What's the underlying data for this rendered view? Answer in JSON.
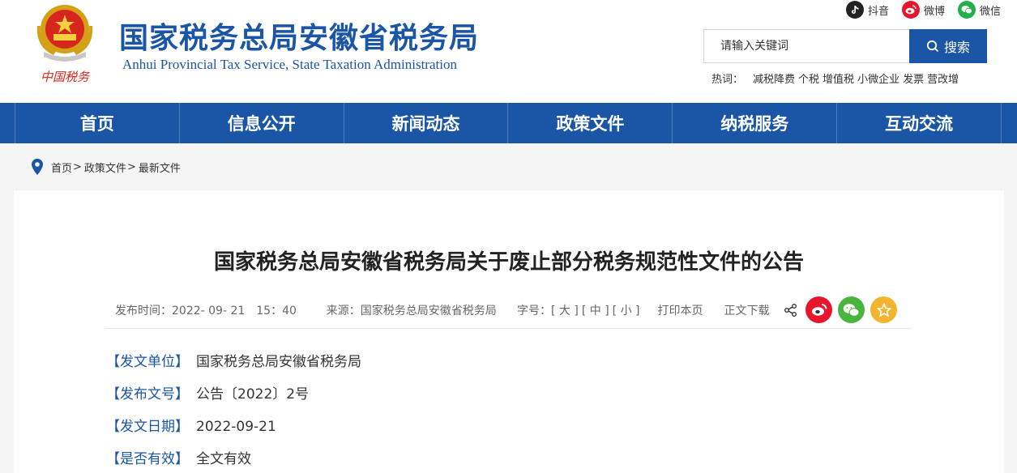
{
  "site": {
    "title": "国家税务总局安徽省税务局",
    "subtitle": "Anhui Provincial Tax Service, State Taxation Administration",
    "emblem_caption": "中国税务"
  },
  "social": [
    {
      "label": "抖音",
      "icon": "douyin-icon",
      "color": "#222222"
    },
    {
      "label": "微博",
      "icon": "weibo-icon",
      "color": "#e6162d"
    },
    {
      "label": "微信",
      "icon": "wechat-icon",
      "color": "#21b04b"
    }
  ],
  "search": {
    "placeholder": "请输入关键词",
    "button_label": "搜索"
  },
  "hotwords": {
    "label": "热词：",
    "items": [
      "减税降费",
      "个税",
      "增值税",
      "小微企业",
      "发票",
      "营改增"
    ]
  },
  "nav": {
    "items": [
      "首页",
      "信息公开",
      "新闻动态",
      "政策文件",
      "纳税服务",
      "互动交流"
    ]
  },
  "breadcrumb": {
    "items": [
      "首页",
      "政策文件",
      "最新文件"
    ],
    "separator": ">"
  },
  "article": {
    "title": "国家税务总局安徽省税务局关于废止部分税务规范性文件的公告",
    "publish_time": "发布时间：2022- 09- 21　15：40",
    "source": "来源：国家税务总局安徽省税务局",
    "font_size_label": "字号：",
    "font_large": "[ 大 ]",
    "font_medium": "[ 中 ]",
    "font_small": "[ 小 ]",
    "print_label": "打印本页",
    "download_label": "正文下载",
    "info": [
      {
        "label": "【发文单位】",
        "value": "国家税务总局安徽省税务局"
      },
      {
        "label": "【发布文号】",
        "value": "公告〔2022〕2号"
      },
      {
        "label": "【发文日期】",
        "value": "2022-09-21"
      },
      {
        "label": "【是否有效】",
        "value": "全文有效"
      }
    ]
  },
  "colors": {
    "brand_blue": "#1b55a6",
    "weibo_red": "#e6162d",
    "wechat_green": "#4ab53e",
    "favorite_yellow": "#f3b52e"
  }
}
